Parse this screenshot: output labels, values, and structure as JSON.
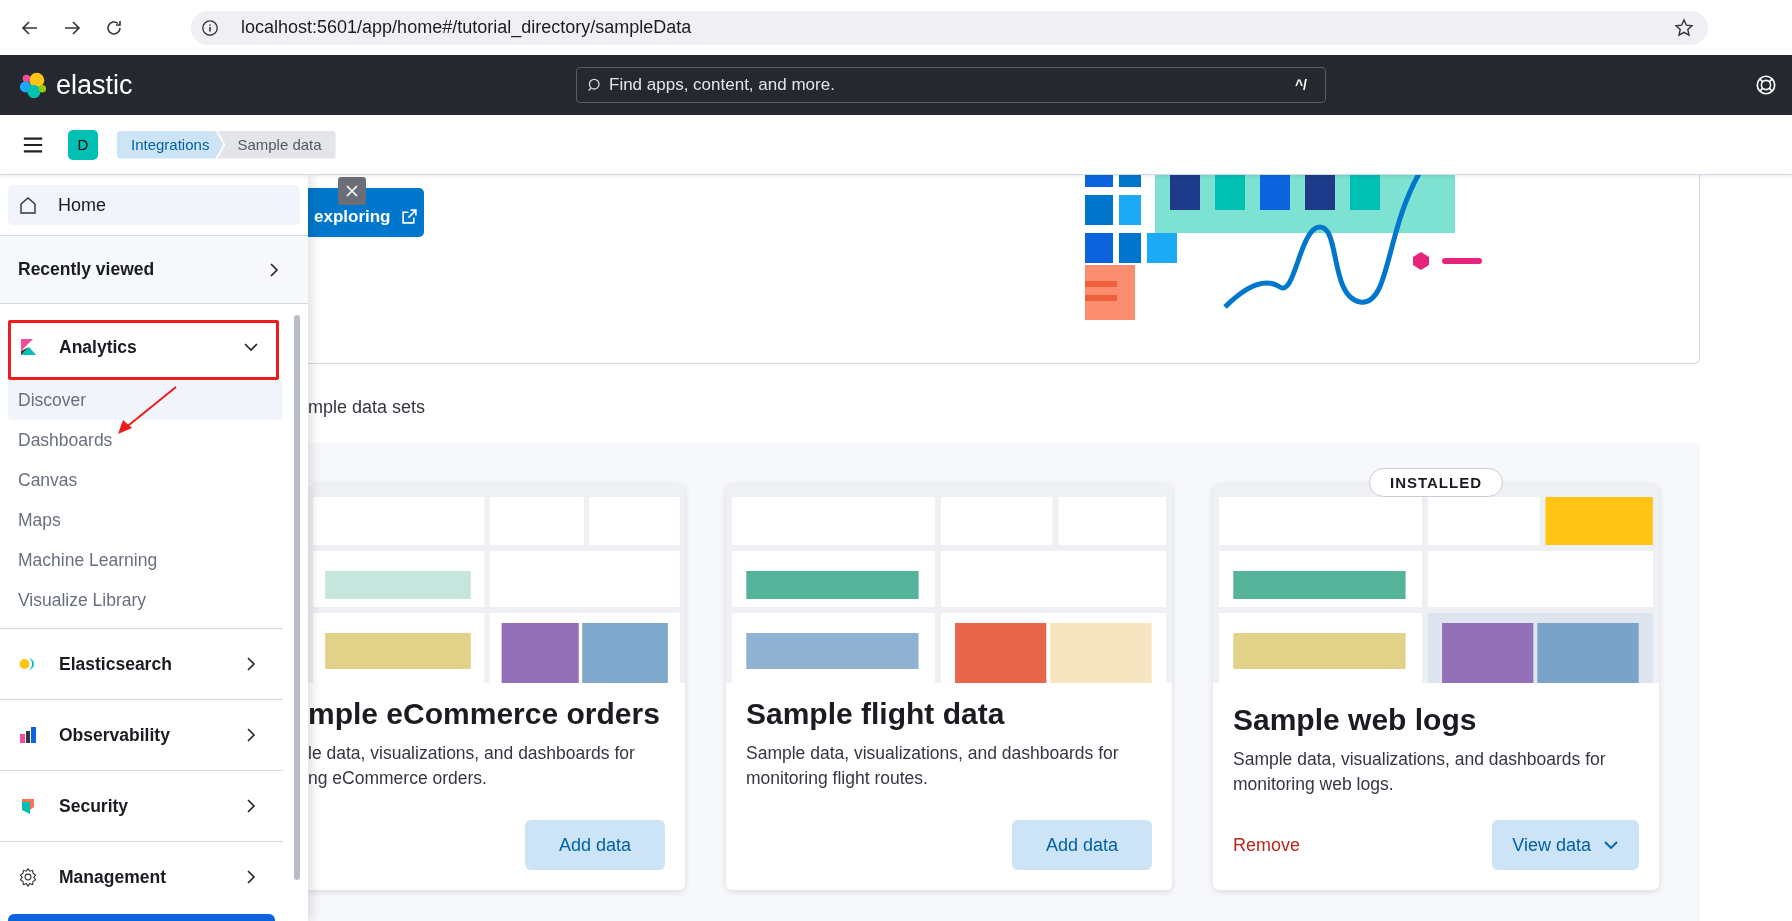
{
  "browser": {
    "url": "localhost:5601/app/home#/tutorial_directory/sampleData"
  },
  "header": {
    "logo_text": "elastic",
    "search": {
      "placeholder": "Find apps, content, and more.",
      "shortcut": "^/"
    }
  },
  "breadcrumbs": {
    "space_initial": "D",
    "items": [
      {
        "label": "Integrations",
        "selected": false
      },
      {
        "label": "Sample data",
        "selected": true
      }
    ]
  },
  "nav": {
    "home": "Home",
    "recently_viewed": "Recently viewed",
    "sections": [
      {
        "label": "Analytics",
        "expanded": true,
        "items": [
          {
            "label": "Discover",
            "selected": true
          },
          {
            "label": "Dashboards",
            "selected": false
          },
          {
            "label": "Canvas",
            "selected": false
          },
          {
            "label": "Maps",
            "selected": false
          },
          {
            "label": "Machine Learning",
            "selected": false
          },
          {
            "label": "Visualize Library",
            "selected": false
          }
        ]
      },
      {
        "label": "Elasticsearch",
        "expanded": false
      },
      {
        "label": "Observability",
        "expanded": false
      },
      {
        "label": "Security",
        "expanded": false
      },
      {
        "label": "Management",
        "expanded": false
      }
    ]
  },
  "intro": {
    "button": "exploring",
    "section_heading": "mple data sets"
  },
  "cards": [
    {
      "title": "mple eCommerce orders",
      "lines": [
        "le data, visualizations, and dashboards for",
        "ng eCommerce orders."
      ],
      "actions": [
        {
          "label": "Add data",
          "kind": "primary"
        }
      ]
    },
    {
      "title": "Sample flight data",
      "lines": [
        "Sample data, visualizations, and dashboards for",
        "monitoring flight routes."
      ],
      "actions": [
        {
          "label": "Add data",
          "kind": "primary"
        }
      ]
    },
    {
      "title": "Sample web logs",
      "badge": "INSTALLED",
      "lines": [
        "Sample data, visualizations, and dashboards for",
        "monitoring web logs."
      ],
      "actions": [
        {
          "label": "Remove",
          "kind": "link"
        },
        {
          "label": "View data",
          "kind": "dropdown"
        }
      ]
    }
  ]
}
